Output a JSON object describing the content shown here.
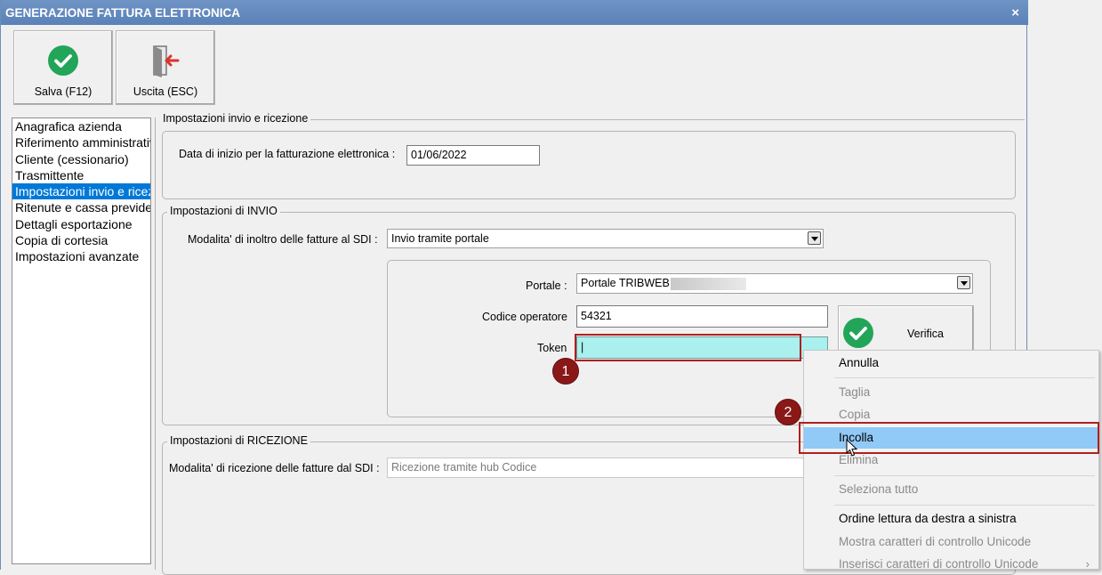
{
  "window": {
    "title": "GENERAZIONE FATTURA ELETTRONICA",
    "close_glyph": "×"
  },
  "toolbar": {
    "save_label": "Salva (F12)",
    "save_icon": "check-circle-icon",
    "exit_label": "Uscita (ESC)",
    "exit_icon": "exit-door-icon"
  },
  "nav": {
    "items": [
      "Anagrafica azienda",
      "Riferimento amministrativo",
      "Cliente (cessionario)",
      "Trasmittente",
      "Impostazioni invio e ricezione",
      "Ritenute e cassa previdenziale",
      "Dettagli esportazione",
      "Copia di cortesia",
      "Impostazioni avanzate"
    ],
    "selected_index": 4
  },
  "group_general": {
    "title": "Impostazioni invio e ricezione",
    "start_date_label": "Data di inizio per la fatturazione elettronica :",
    "start_date_value": "01/06/2022"
  },
  "group_send": {
    "title": "Impostazioni di INVIO",
    "mode_label": "Modalita' di inoltro delle fatture al SDI :",
    "mode_value": "Invio tramite portale",
    "portal_label": "Portale :",
    "portal_value": "Portale TRIBWEB",
    "operator_label": "Codice operatore",
    "operator_value": "54321",
    "token_label": "Token",
    "token_value": "|",
    "verify_label": "Verifica"
  },
  "group_receive": {
    "title": "Impostazioni di RICEZIONE",
    "mode_label": "Modalita' di ricezione delle fatture dal SDI :",
    "mode_value": "Ricezione tramite hub Codice"
  },
  "markers": {
    "one": "1",
    "two": "2"
  },
  "context_menu": {
    "undo": "Annulla",
    "cut": "Taglia",
    "copy": "Copia",
    "paste": "Incolla",
    "delete": "Elimina",
    "select_all": "Seleziona tutto",
    "rtl": "Ordine lettura da destra a sinistra",
    "show_unicode": "Mostra caratteri di controllo Unicode",
    "insert_unicode": "Inserisci caratteri di controllo Unicode",
    "submenu_glyph": "›"
  },
  "colors": {
    "title_bar": "#5f88be",
    "selection": "#0078d7",
    "token_field": "#a9f0ee",
    "highlight": "#91c9f7",
    "annotation_red": "#8a1818",
    "check_green": "#22a559"
  }
}
